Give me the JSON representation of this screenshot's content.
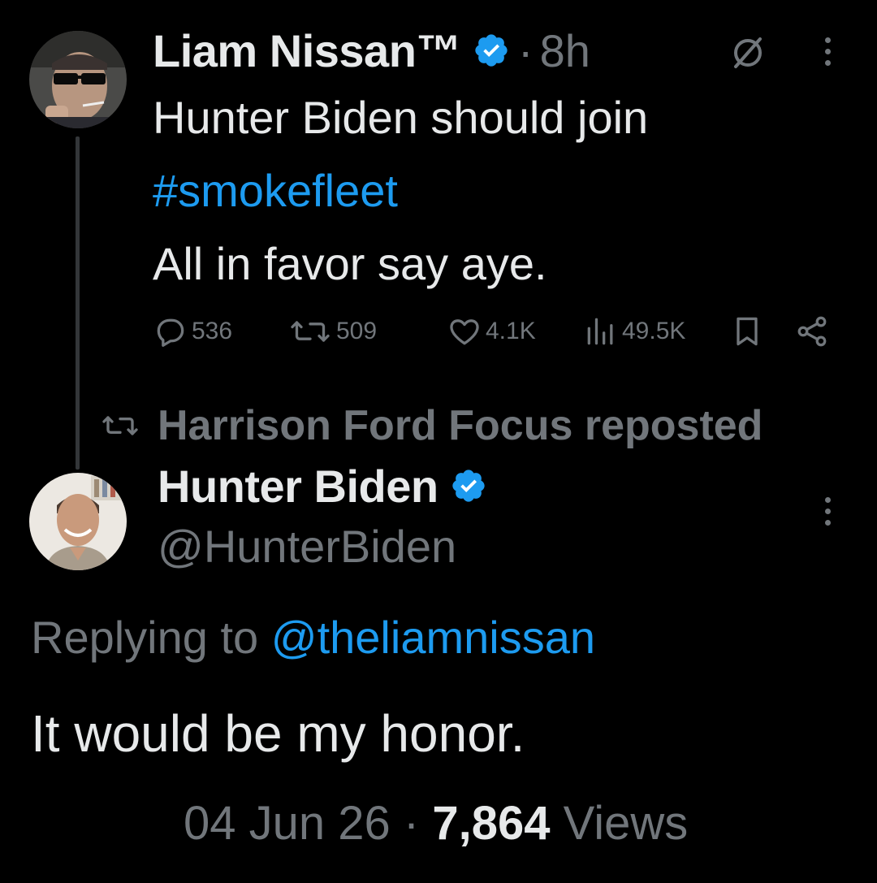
{
  "tweet1": {
    "author_name": "Liam Nissan™",
    "separator": "·",
    "time": "8h",
    "line1": "Hunter Biden should join",
    "hashtag": "#smokefleet",
    "line3": "All in favor say aye.",
    "replies": "536",
    "reposts": "509",
    "likes": "4.1K",
    "views": "49.5K"
  },
  "repost_banner": {
    "text": "Harrison Ford Focus reposted"
  },
  "tweet2": {
    "author_name": "Hunter Biden",
    "handle": "@HunterBiden",
    "replying_prefix": "Replying to ",
    "replying_handle": "@theliamnissan",
    "text": "It would be my honor.",
    "date": "04 Jun 26",
    "separator": " · ",
    "views_count": "7,864",
    "views_label": " Views"
  },
  "colors": {
    "background": "#000000",
    "text_primary": "#e7e9ea",
    "text_secondary": "#71767b",
    "accent": "#1d9bf0"
  },
  "icons": {
    "verified": "verified-badge-icon",
    "muted": "muted-circle-slash-icon",
    "more": "vertical-ellipsis-icon",
    "reply": "speech-bubble-icon",
    "repost": "repost-arrows-icon",
    "like": "heart-icon",
    "views": "bar-chart-icon",
    "bookmark": "bookmark-icon",
    "share": "share-nodes-icon"
  }
}
